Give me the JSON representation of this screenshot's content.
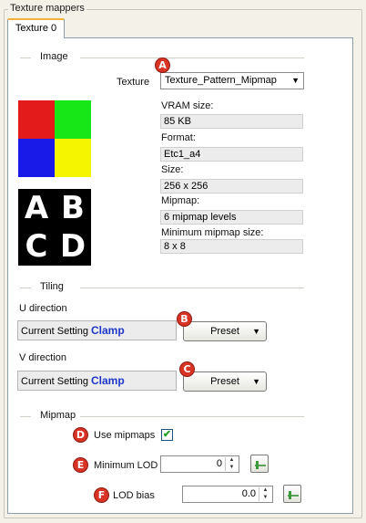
{
  "group_title": "Texture mappers",
  "tab_label": "Texture 0",
  "image_section": {
    "title": "Image",
    "texture_label": "Texture",
    "texture_value": "Texture_Pattern_Mipmap",
    "vram_label": "VRAM size:",
    "vram_value": "85 KB",
    "format_label": "Format:",
    "format_value": "Etc1_a4",
    "size_label": "Size:",
    "size_value": "256 x 256",
    "mipmap_label": "Mipmap:",
    "mipmap_value": "6 mipmap levels",
    "min_mipmap_label": "Minimum mipmap size:",
    "min_mipmap_value": "8 x 8",
    "preview_colors": [
      "#e31b1b",
      "#17e617",
      "#1a1ae8",
      "#f5f500"
    ],
    "alpha_letters": [
      "A",
      "B",
      "C",
      "D"
    ]
  },
  "tiling_section": {
    "title": "Tiling",
    "u_label": "U direction",
    "u_setting_prefix": "Current Setting",
    "u_setting_value": "Clamp",
    "u_preset_label": "Preset",
    "v_label": "V direction",
    "v_setting_prefix": "Current Setting",
    "v_setting_value": "Clamp",
    "v_preset_label": "Preset"
  },
  "mipmap_section": {
    "title": "Mipmap",
    "use_mipmaps_label": "Use mipmaps",
    "use_mipmaps_checked": true,
    "min_lod_label": "Minimum LOD",
    "min_lod_value": "0",
    "lod_bias_label": "LOD bias",
    "lod_bias_value": "0.0"
  },
  "badges": [
    "A",
    "B",
    "C",
    "D",
    "E",
    "F"
  ],
  "colors": {
    "badge": "#d83325",
    "setting_value": "#1f37c8",
    "tab_accent": "#f4b23a"
  }
}
